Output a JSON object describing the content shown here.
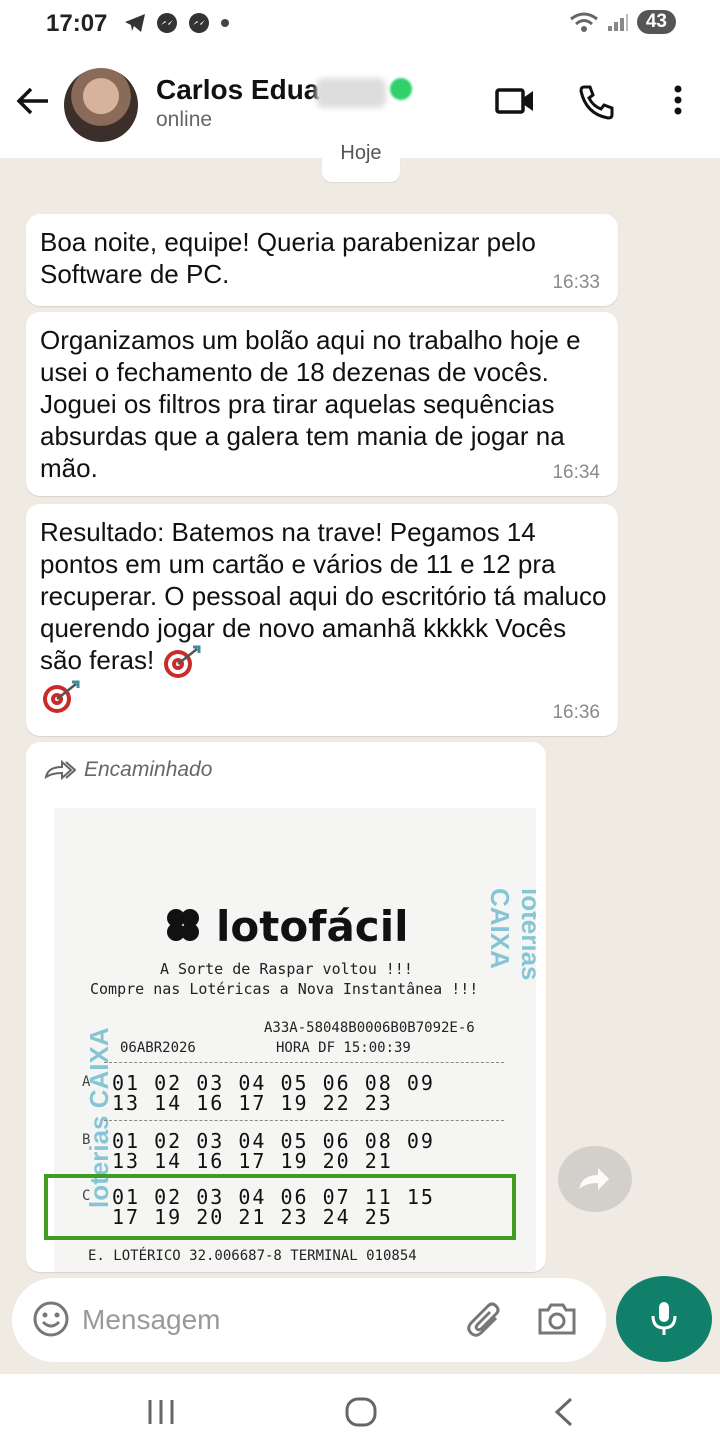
{
  "status_bar": {
    "time": "17:07",
    "battery": "43"
  },
  "header": {
    "contact_name": "Carlos Edua",
    "status": "online"
  },
  "date_chip": "Hoje",
  "messages": [
    {
      "text": "Boa noite, equipe! Queria parabenizar pelo Software de PC.",
      "time": "16:33"
    },
    {
      "text": "Organizamos um bolão aqui no trabalho hoje e usei o fechamento de 18 dezenas de vocês. Joguei os filtros pra tirar aquelas sequências absurdas que a galera tem mania de jogar na mão.",
      "time": "16:34"
    },
    {
      "text": "Resultado: Batemos na trave! Pegamos 14 pontos em um cartão e vários de 11 e 12 pra recuperar. O pessoal aqui do escritório tá maluco querendo jogar de novo amanhã kkkkk Vocês são feras!",
      "time": "16:36"
    }
  ],
  "forwarded": {
    "label": "Encaminhado",
    "ticket": {
      "logo": "lotofácil",
      "slogan1": "A Sorte de Raspar voltou !!!",
      "slogan2": "Compre nas Lotéricas a Nova Instantânea !!!",
      "code": "A33A-58048B0006B0B7092E-6",
      "date": "06ABR2026",
      "hour": "HORA DF 15:00:39",
      "watermark_left": "loterias CAIXA",
      "watermark_right": "loterias CAIXA",
      "rows": [
        {
          "label": "A",
          "line1": "01 02 03 04 05 06 08 09",
          "line2": "13 14 16 17 19 22 23"
        },
        {
          "label": "B",
          "line1": "01 02 03 04 05 06 08 09",
          "line2": "13 14 16 17 19 20 21"
        },
        {
          "label": "C",
          "line1": "01 02 03 04 06 07 11 15",
          "line2": "17 19 20 21 23 24 25"
        }
      ],
      "footer": "E. LOTÉRICO 32.006687-8    TERMINAL  010854"
    }
  },
  "composer": {
    "placeholder": "Mensagem"
  },
  "colors": {
    "accent": "#11806a",
    "highlight": "#3f9d22",
    "chat_bg": "#efeae2"
  }
}
